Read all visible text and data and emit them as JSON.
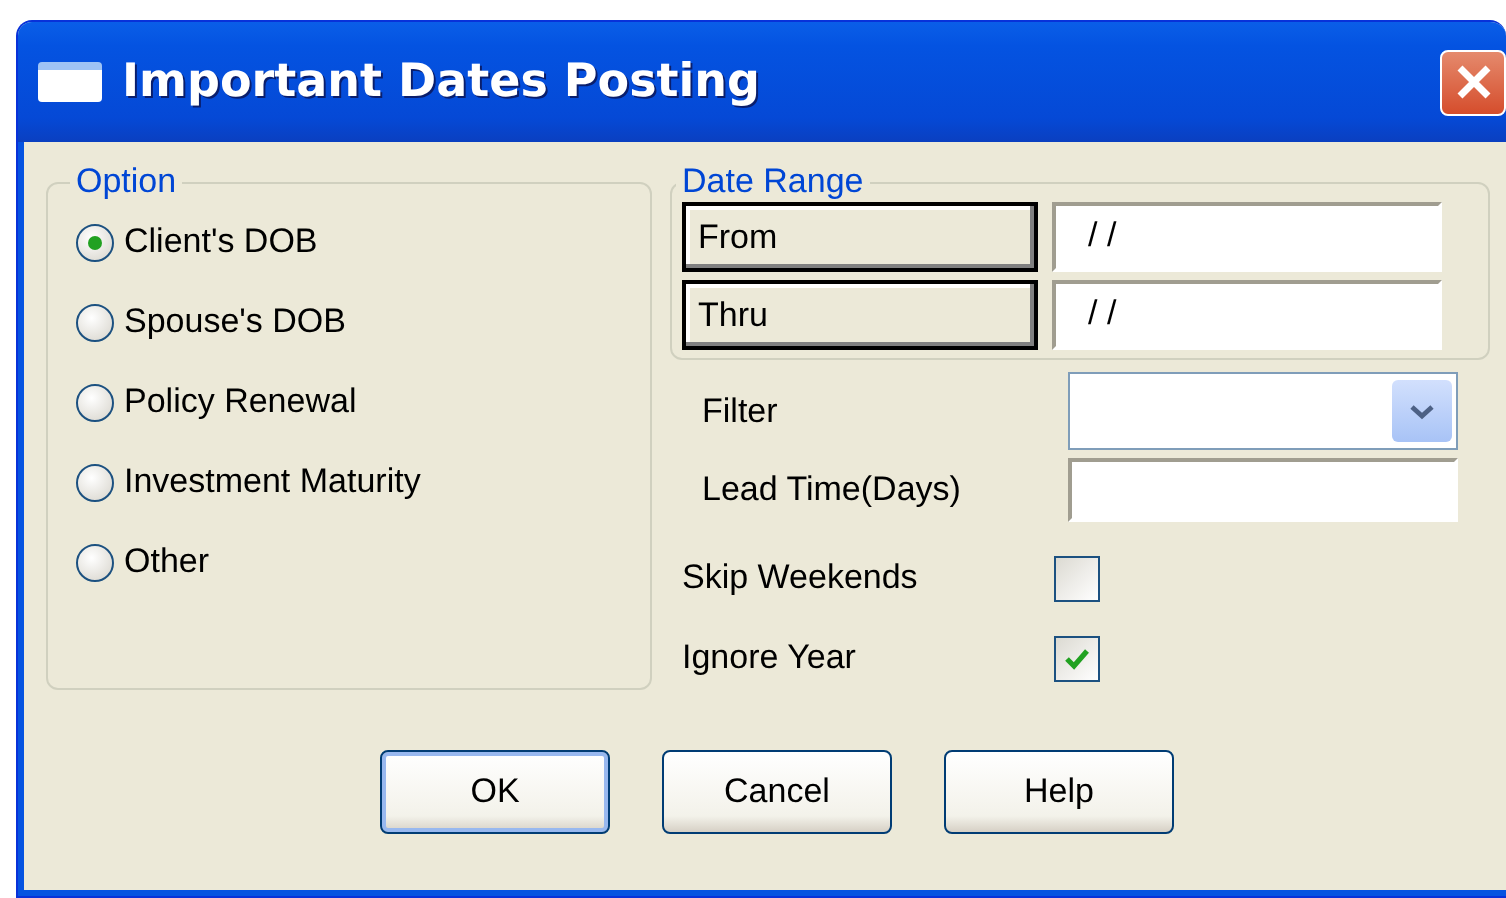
{
  "window": {
    "title": "Important Dates Posting"
  },
  "option_group": {
    "title": "Option",
    "options": [
      {
        "label": "Client's DOB",
        "selected": true
      },
      {
        "label": "Spouse's DOB",
        "selected": false
      },
      {
        "label": "Policy Renewal",
        "selected": false
      },
      {
        "label": "Investment Maturity",
        "selected": false
      },
      {
        "label": "Other",
        "selected": false
      }
    ]
  },
  "date_range": {
    "title": "Date Range",
    "rows": [
      {
        "button": "From",
        "value": "/ /"
      },
      {
        "button": "Thru",
        "value": "/ /"
      }
    ]
  },
  "filter": {
    "label": "Filter"
  },
  "lead_time": {
    "label": "Lead Time(Days)"
  },
  "checkboxes": [
    {
      "label": "Skip Weekends",
      "checked": false
    },
    {
      "label": "Ignore Year",
      "checked": true
    }
  ],
  "buttons": [
    {
      "label": "OK",
      "default": true
    },
    {
      "label": "Cancel",
      "default": false
    },
    {
      "label": "Help",
      "default": false
    }
  ]
}
